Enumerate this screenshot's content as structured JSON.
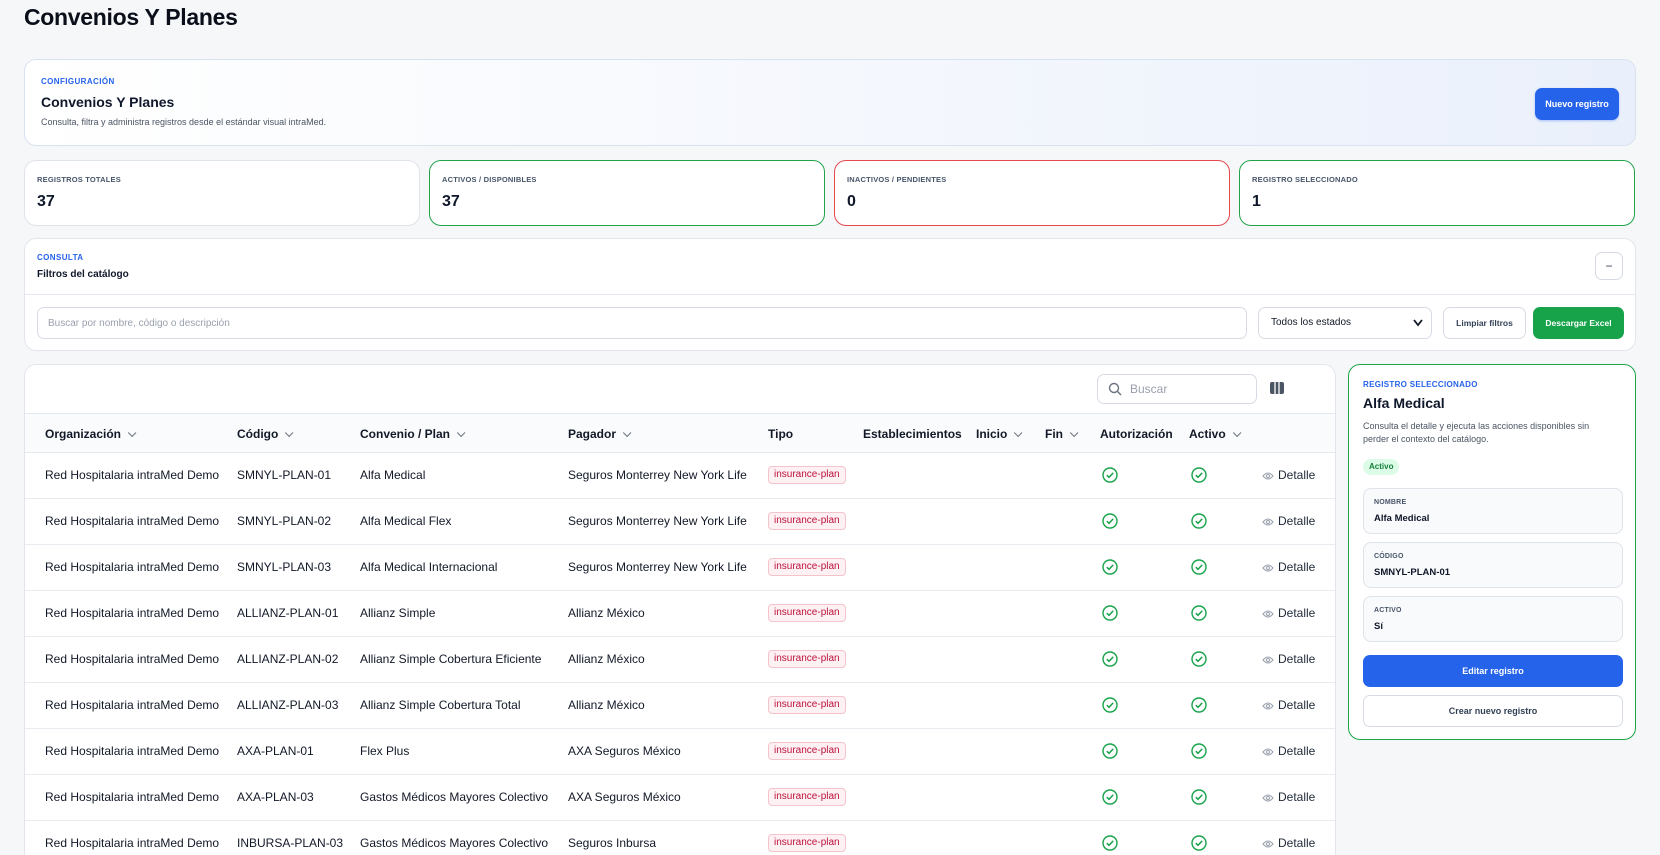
{
  "page": {
    "title": "Convenios Y Planes"
  },
  "hero": {
    "kicker": "CONFIGURACIÓN",
    "title": "Convenios Y Planes",
    "subtitle": "Consulta, filtra y administra registros desde el estándar visual intraMed.",
    "new_button": "Nuevo registro"
  },
  "stats": [
    {
      "label": "REGISTROS TOTALES",
      "value": "37"
    },
    {
      "label": "ACTIVOS / DISPONIBLES",
      "value": "37"
    },
    {
      "label": "INACTIVOS / PENDIENTES",
      "value": "0"
    },
    {
      "label": "REGISTRO SELECCIONADO",
      "value": "1"
    }
  ],
  "filters": {
    "kicker": "CONSULTA",
    "title": "Filtros del catálogo",
    "collapse_label": "−",
    "search_placeholder": "Buscar por nombre, código o descripción",
    "state_selected": "Todos los estados",
    "clear_button": "Limpiar filtros",
    "excel_button": "Descargar Excel"
  },
  "table": {
    "search_placeholder": "Buscar",
    "columns": [
      "Organización",
      "Código",
      "Convenio / Plan",
      "Pagador",
      "Tipo",
      "Establecimientos",
      "Inicio",
      "Fin",
      "Autorización",
      "Activo"
    ],
    "detail_label": "Detalle",
    "rows": [
      {
        "org": "Red Hospitalaria intraMed Demo",
        "code": "SMNYL-PLAN-01",
        "plan": "Alfa Medical",
        "payer": "Seguros Monterrey New York Life",
        "type": "insurance-plan"
      },
      {
        "org": "Red Hospitalaria intraMed Demo",
        "code": "SMNYL-PLAN-02",
        "plan": "Alfa Medical Flex",
        "payer": "Seguros Monterrey New York Life",
        "type": "insurance-plan"
      },
      {
        "org": "Red Hospitalaria intraMed Demo",
        "code": "SMNYL-PLAN-03",
        "plan": "Alfa Medical Internacional",
        "payer": "Seguros Monterrey New York Life",
        "type": "insurance-plan"
      },
      {
        "org": "Red Hospitalaria intraMed Demo",
        "code": "ALLIANZ-PLAN-01",
        "plan": "Allianz Simple",
        "payer": "Allianz México",
        "type": "insurance-plan"
      },
      {
        "org": "Red Hospitalaria intraMed Demo",
        "code": "ALLIANZ-PLAN-02",
        "plan": "Allianz Simple Cobertura Eficiente",
        "payer": "Allianz México",
        "type": "insurance-plan"
      },
      {
        "org": "Red Hospitalaria intraMed Demo",
        "code": "ALLIANZ-PLAN-03",
        "plan": "Allianz Simple Cobertura Total",
        "payer": "Allianz México",
        "type": "insurance-plan"
      },
      {
        "org": "Red Hospitalaria intraMed Demo",
        "code": "AXA-PLAN-01",
        "plan": "Flex Plus",
        "payer": "AXA Seguros México",
        "type": "insurance-plan"
      },
      {
        "org": "Red Hospitalaria intraMed Demo",
        "code": "AXA-PLAN-03",
        "plan": "Gastos Médicos Mayores Colectivo",
        "payer": "AXA Seguros México",
        "type": "insurance-plan"
      },
      {
        "org": "Red Hospitalaria intraMed Demo",
        "code": "INBURSA-PLAN-03",
        "plan": "Gastos Médicos Mayores Colectivo",
        "payer": "Seguros Inbursa",
        "type": "insurance-plan"
      }
    ]
  },
  "side": {
    "kicker": "REGISTRO SELECCIONADO",
    "title": "Alfa Medical",
    "description": "Consulta el detalle y ejecuta las acciones disponibles sin perder el contexto del catálogo.",
    "status": "Activo",
    "fields": [
      {
        "label": "NOMBRE",
        "value": "Alfa Medical"
      },
      {
        "label": "CÓDIGO",
        "value": "SMNYL-PLAN-01"
      },
      {
        "label": "ACTIVO",
        "value": "Sí"
      }
    ],
    "edit_button": "Editar registro",
    "new_button": "Crear nuevo registro"
  },
  "colors": {
    "primary": "#2563eb",
    "success": "#16a34a",
    "danger": "#e5484d",
    "badge_text": "#be123c"
  }
}
